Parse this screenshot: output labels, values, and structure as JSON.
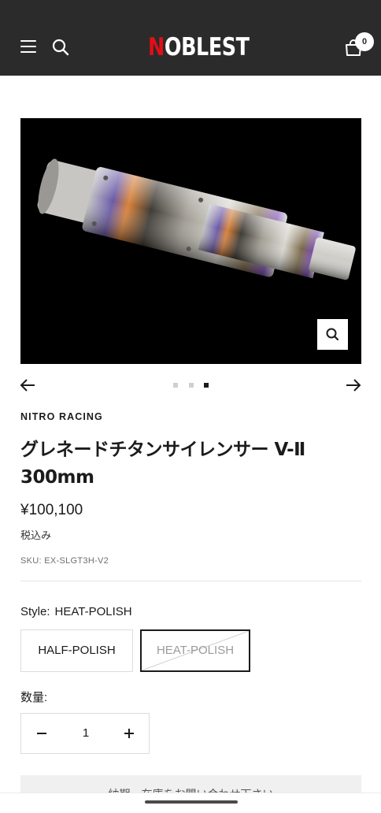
{
  "header": {
    "logo_first_letter": "N",
    "logo_rest": "OBLEST",
    "cart_count": "0",
    "background": "#2b2b2b",
    "logo_accent": "#e10f18"
  },
  "icons": {
    "menu": "hamburger-menu-icon",
    "search": "search-icon",
    "cart": "shopping-bag-icon",
    "zoom": "magnifier-zoom-icon",
    "prev": "arrow-left-icon",
    "next": "arrow-right-icon"
  },
  "gallery": {
    "slide_count": 3,
    "active_slide": 3
  },
  "product": {
    "vendor": "NITRO RACING",
    "title": "グレネードチタンサイレンサー V-Ⅱ 300mm",
    "price": "¥100,100",
    "tax_note": "税込み",
    "sku": "SKU: EX-SLGT3H-V2"
  },
  "variant": {
    "label": "Style:",
    "selected": "HEAT-POLISH",
    "options": [
      {
        "label": "HALF-POLISH",
        "available": true
      },
      {
        "label": "HEAT-POLISH",
        "available": false
      }
    ]
  },
  "quantity": {
    "label": "数量:",
    "value": "1"
  },
  "notice": {
    "text": "納期・在庫をお問い合わせ下さい"
  }
}
